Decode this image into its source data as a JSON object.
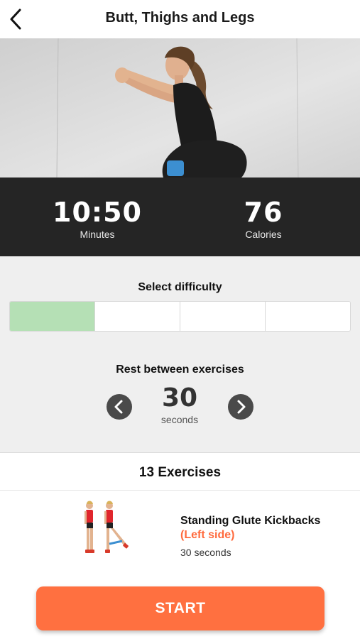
{
  "header": {
    "title": "Butt, Thighs and Legs",
    "back_icon": "chevron-left-icon"
  },
  "stats": {
    "duration": {
      "value": "10:50",
      "label": "Minutes"
    },
    "calories": {
      "value": "76",
      "label": "Calories"
    }
  },
  "difficulty": {
    "title": "Select difficulty",
    "levels": 4,
    "selected_level": 1,
    "active_color": "#b5e0b5"
  },
  "rest": {
    "title": "Rest between exercises",
    "value": "30",
    "unit": "seconds",
    "prev_icon": "chevron-left-icon",
    "next_icon": "chevron-right-icon"
  },
  "exercises": {
    "count_label": "13 Exercises",
    "items": [
      {
        "name": "Standing Glute Kickbacks",
        "side": "(Left side)",
        "duration": "30 seconds"
      }
    ]
  },
  "start_label": "START",
  "colors": {
    "accent": "#ff7040",
    "stats_bg": "#252525",
    "side_text": "#ff6a3d"
  }
}
